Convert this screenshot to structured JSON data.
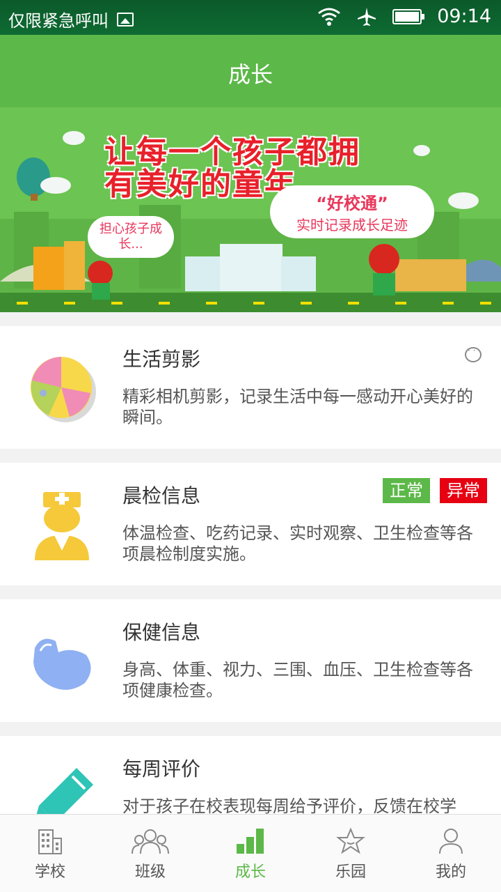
{
  "status": {
    "left_text": "仅限紧急呼叫",
    "time": "09:14"
  },
  "header": {
    "title": "成长"
  },
  "banner": {
    "slogan_line1": "让每一个孩子都拥",
    "slogan_line2": "有美好的童年",
    "bubble_left": "担心孩子成长...",
    "bubble_right_title": "“好校通”",
    "bubble_right_sub": "实时记录成长足迹"
  },
  "cards": [
    {
      "title": "生活剪影",
      "desc": "精彩相机剪影，记录生活中每一感动开心美好的瞬间。"
    },
    {
      "title": "晨检信息",
      "desc": "体温检查、吃药记录、实时观察、卫生检查等各项晨检制度实施。",
      "badge_normal": "正常",
      "badge_abnormal": "异常"
    },
    {
      "title": "保健信息",
      "desc": "身高、体重、视力、三围、血压、卫生检查等各项健康检查。"
    },
    {
      "title": "每周评价",
      "desc": "对于孩子在校表现每周给予评价，反馈在校学"
    }
  ],
  "tabs": [
    {
      "label": "学校"
    },
    {
      "label": "班级"
    },
    {
      "label": "成长"
    },
    {
      "label": "乐园"
    },
    {
      "label": "我的"
    }
  ],
  "colors": {
    "primary": "#5cb848",
    "badge_normal": "#5cb848",
    "badge_abnormal": "#e60012"
  }
}
